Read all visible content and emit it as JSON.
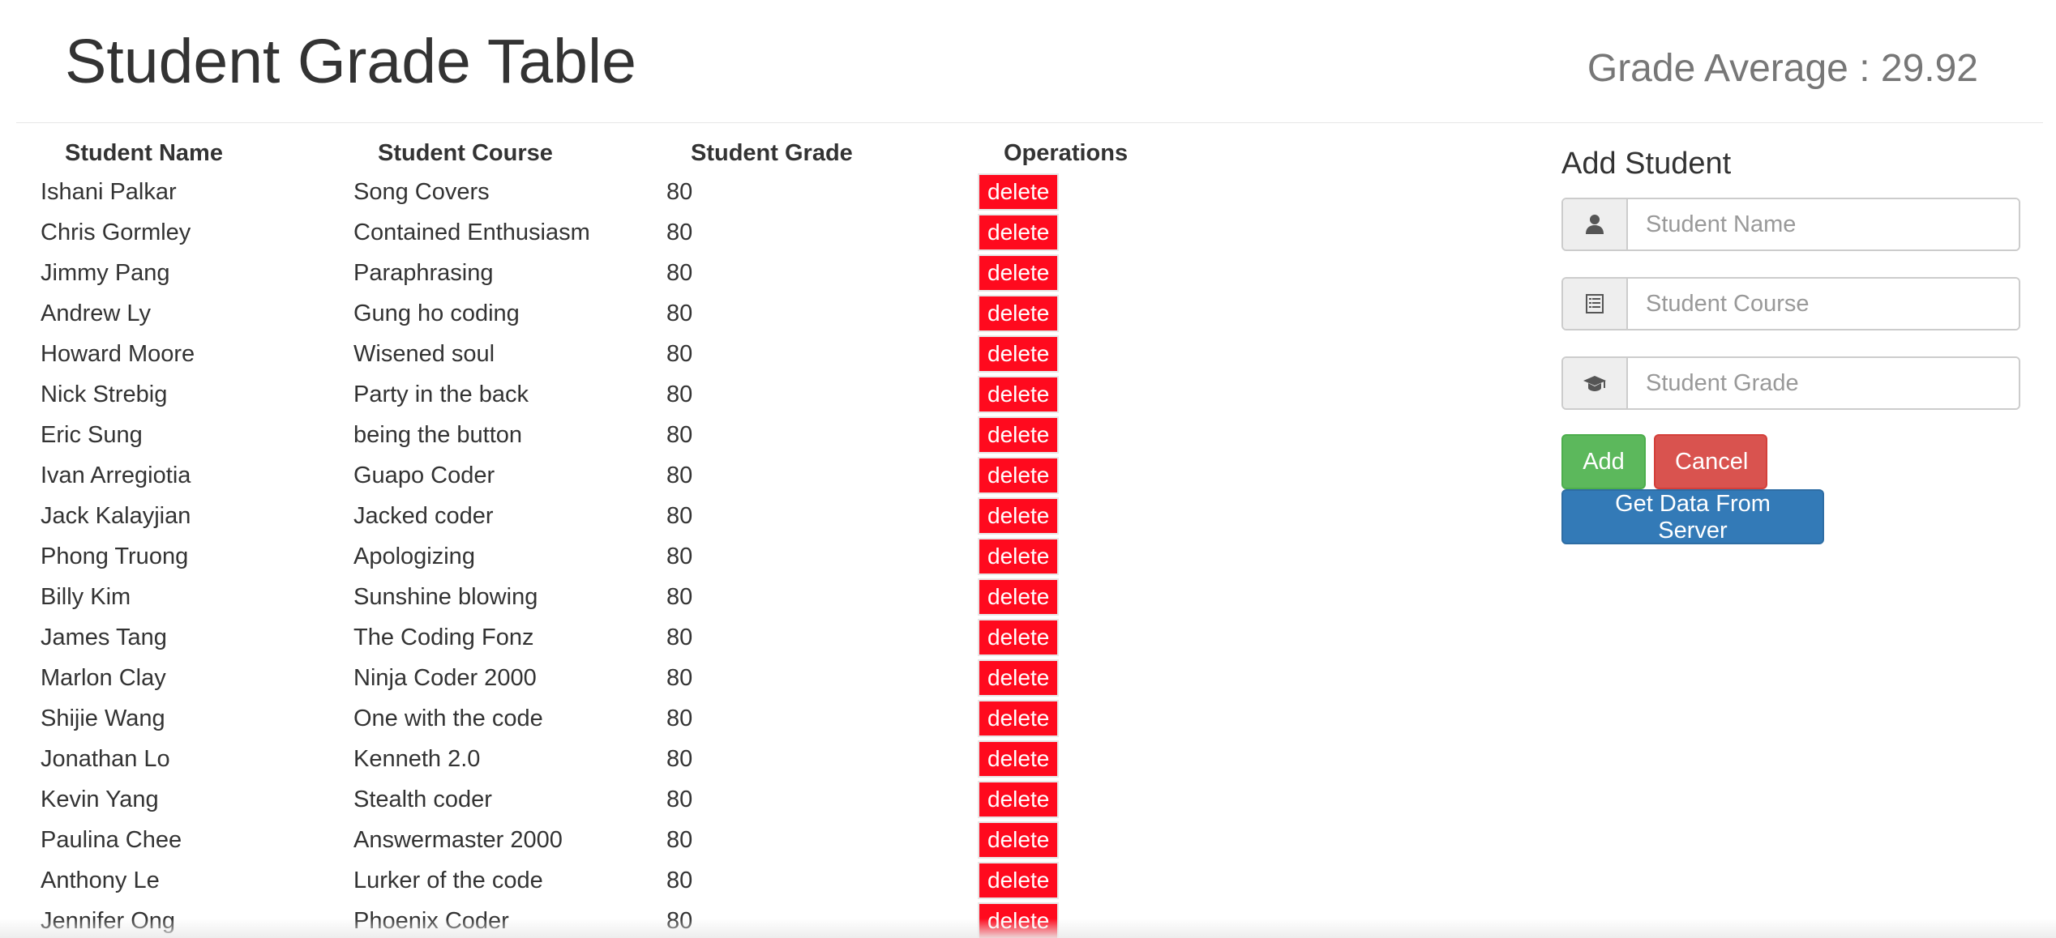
{
  "header": {
    "title": "Student Grade Table",
    "average_label": "Grade Average : ",
    "average_value": "29.92"
  },
  "table": {
    "headers": [
      "Student Name",
      "Student Course",
      "Student Grade",
      "Operations"
    ],
    "delete_label": "delete",
    "rows": [
      {
        "name": "Ishani Palkar",
        "course": "Song Covers",
        "grade": "80"
      },
      {
        "name": "Chris Gormley",
        "course": "Contained Enthusiasm",
        "grade": "80"
      },
      {
        "name": "Jimmy Pang",
        "course": "Paraphrasing",
        "grade": "80"
      },
      {
        "name": "Andrew Ly",
        "course": "Gung ho coding",
        "grade": "80"
      },
      {
        "name": "Howard Moore",
        "course": "Wisened soul",
        "grade": "80"
      },
      {
        "name": "Nick Strebig",
        "course": "Party in the back",
        "grade": "80"
      },
      {
        "name": "Eric Sung",
        "course": "being the button",
        "grade": "80"
      },
      {
        "name": "Ivan Arregiotia",
        "course": "Guapo Coder",
        "grade": "80"
      },
      {
        "name": "Jack Kalayjian",
        "course": "Jacked coder",
        "grade": "80"
      },
      {
        "name": "Phong Truong",
        "course": "Apologizing",
        "grade": "80"
      },
      {
        "name": "Billy Kim",
        "course": "Sunshine blowing",
        "grade": "80"
      },
      {
        "name": "James Tang",
        "course": "The Coding Fonz",
        "grade": "80"
      },
      {
        "name": "Marlon Clay",
        "course": "Ninja Coder 2000",
        "grade": "80"
      },
      {
        "name": "Shijie Wang",
        "course": "One with the code",
        "grade": "80"
      },
      {
        "name": "Jonathan Lo",
        "course": "Kenneth 2.0",
        "grade": "80"
      },
      {
        "name": "Kevin Yang",
        "course": "Stealth coder",
        "grade": "80"
      },
      {
        "name": "Paulina Chee",
        "course": "Answermaster 2000",
        "grade": "80"
      },
      {
        "name": "Anthony Le",
        "course": "Lurker of the code",
        "grade": "80"
      },
      {
        "name": "Jennifer Ong",
        "course": "Phoenix Coder",
        "grade": "80"
      }
    ]
  },
  "add_student": {
    "title": "Add Student",
    "fields": [
      {
        "placeholder": "Student Name",
        "icon": "user-icon"
      },
      {
        "placeholder": "Student Course",
        "icon": "list-icon"
      },
      {
        "placeholder": "Student Grade",
        "icon": "graduation-cap-icon"
      }
    ],
    "add_label": "Add",
    "cancel_label": "Cancel",
    "server_label": "Get Data From Server"
  },
  "colors": {
    "delete": "#ff0a1e",
    "add": "#5cb85c",
    "cancel": "#d9534f",
    "server": "#337ab7"
  }
}
